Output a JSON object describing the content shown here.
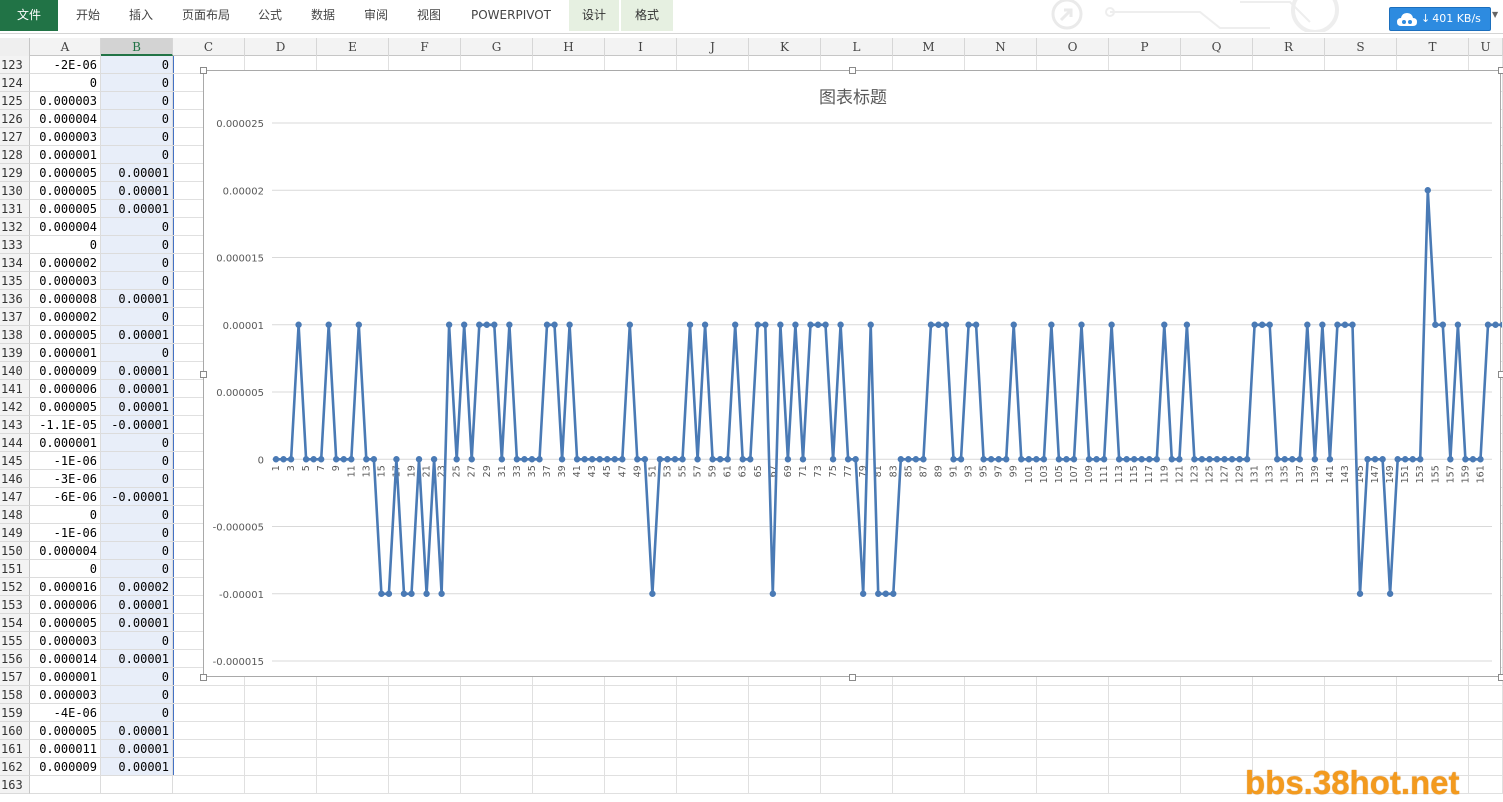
{
  "ribbon": {
    "tabs": [
      {
        "label": "文件",
        "kind": "file",
        "x": 0,
        "w": 58
      },
      {
        "label": "开始",
        "kind": "",
        "x": 62,
        "w": 52
      },
      {
        "label": "插入",
        "kind": "",
        "x": 116,
        "w": 50
      },
      {
        "label": "页面布局",
        "kind": "",
        "x": 170,
        "w": 72
      },
      {
        "label": "公式",
        "kind": "",
        "x": 245,
        "w": 50
      },
      {
        "label": "数据",
        "kind": "",
        "x": 298,
        "w": 50
      },
      {
        "label": "审阅",
        "kind": "",
        "x": 351,
        "w": 50
      },
      {
        "label": "视图",
        "kind": "",
        "x": 404,
        "w": 50
      },
      {
        "label": "POWERPIVOT",
        "kind": "",
        "x": 459,
        "w": 104
      },
      {
        "label": "设计",
        "kind": "ctx",
        "x": 569,
        "w": 50
      },
      {
        "label": "格式",
        "kind": "ctx",
        "x": 621,
        "w": 52
      }
    ],
    "speed": "401 KB/s"
  },
  "columns": [
    "A",
    "B",
    "C",
    "D",
    "E",
    "F",
    "G",
    "H",
    "I",
    "J",
    "K",
    "L",
    "M",
    "N",
    "O",
    "P",
    "Q",
    "R",
    "S",
    "T",
    "U"
  ],
  "rows": [
    {
      "n": "123",
      "a": "-2E-06",
      "b": "0"
    },
    {
      "n": "124",
      "a": "0",
      "b": "0"
    },
    {
      "n": "125",
      "a": "0.000003",
      "b": "0"
    },
    {
      "n": "126",
      "a": "0.000004",
      "b": "0"
    },
    {
      "n": "127",
      "a": "0.000003",
      "b": "0"
    },
    {
      "n": "128",
      "a": "0.000001",
      "b": "0"
    },
    {
      "n": "129",
      "a": "0.000005",
      "b": "0.00001"
    },
    {
      "n": "130",
      "a": "0.000005",
      "b": "0.00001"
    },
    {
      "n": "131",
      "a": "0.000005",
      "b": "0.00001"
    },
    {
      "n": "132",
      "a": "0.000004",
      "b": "0"
    },
    {
      "n": "133",
      "a": "0",
      "b": "0"
    },
    {
      "n": "134",
      "a": "0.000002",
      "b": "0"
    },
    {
      "n": "135",
      "a": "0.000003",
      "b": "0"
    },
    {
      "n": "136",
      "a": "0.000008",
      "b": "0.00001"
    },
    {
      "n": "137",
      "a": "0.000002",
      "b": "0"
    },
    {
      "n": "138",
      "a": "0.000005",
      "b": "0.00001"
    },
    {
      "n": "139",
      "a": "0.000001",
      "b": "0"
    },
    {
      "n": "140",
      "a": "0.000009",
      "b": "0.00001"
    },
    {
      "n": "141",
      "a": "0.000006",
      "b": "0.00001"
    },
    {
      "n": "142",
      "a": "0.000005",
      "b": "0.00001"
    },
    {
      "n": "143",
      "a": "-1.1E-05",
      "b": "-0.00001"
    },
    {
      "n": "144",
      "a": "0.000001",
      "b": "0"
    },
    {
      "n": "145",
      "a": "-1E-06",
      "b": "0"
    },
    {
      "n": "146",
      "a": "-3E-06",
      "b": "0"
    },
    {
      "n": "147",
      "a": "-6E-06",
      "b": "-0.00001"
    },
    {
      "n": "148",
      "a": "0",
      "b": "0"
    },
    {
      "n": "149",
      "a": "-1E-06",
      "b": "0"
    },
    {
      "n": "150",
      "a": "0.000004",
      "b": "0"
    },
    {
      "n": "151",
      "a": "0",
      "b": "0"
    },
    {
      "n": "152",
      "a": "0.000016",
      "b": "0.00002"
    },
    {
      "n": "153",
      "a": "0.000006",
      "b": "0.00001"
    },
    {
      "n": "154",
      "a": "0.000005",
      "b": "0.00001"
    },
    {
      "n": "155",
      "a": "0.000003",
      "b": "0"
    },
    {
      "n": "156",
      "a": "0.000014",
      "b": "0.00001"
    },
    {
      "n": "157",
      "a": "0.000001",
      "b": "0"
    },
    {
      "n": "158",
      "a": "0.000003",
      "b": "0"
    },
    {
      "n": "159",
      "a": "-4E-06",
      "b": "0"
    },
    {
      "n": "160",
      "a": "0.000005",
      "b": "0.00001"
    },
    {
      "n": "161",
      "a": "0.000011",
      "b": "0.00001"
    },
    {
      "n": "162",
      "a": "0.000009",
      "b": "0.00001"
    },
    {
      "n": "163",
      "a": "",
      "b": ""
    }
  ],
  "watermark": "bbs.38hot.net",
  "chart_data": {
    "type": "line",
    "title": "图表标题",
    "ylim": [
      -1.5e-05,
      2.5e-05
    ],
    "yticks": [
      "0.000025",
      "0.00002",
      "0.000015",
      "0.00001",
      "0.000005",
      "0",
      "-0.000005",
      "-0.00001",
      "-0.000015"
    ],
    "ytick_values": [
      2.5e-05,
      2e-05,
      1.5e-05,
      1e-05,
      5e-06,
      0,
      -5e-06,
      -1e-05,
      -1.5e-05
    ],
    "x_label_step": 2,
    "grid": true,
    "legend": "none",
    "series_color": "#4a7ab5",
    "x": [
      1,
      2,
      3,
      4,
      5,
      6,
      7,
      8,
      9,
      10,
      11,
      12,
      13,
      14,
      15,
      16,
      17,
      18,
      19,
      20,
      21,
      22,
      23,
      24,
      25,
      26,
      27,
      28,
      29,
      30,
      31,
      32,
      33,
      34,
      35,
      36,
      37,
      38,
      39,
      40,
      41,
      42,
      43,
      44,
      45,
      46,
      47,
      48,
      49,
      50,
      51,
      52,
      53,
      54,
      55,
      56,
      57,
      58,
      59,
      60,
      61,
      62,
      63,
      64,
      65,
      66,
      67,
      68,
      69,
      70,
      71,
      72,
      73,
      74,
      75,
      76,
      77,
      78,
      79,
      80,
      81,
      82,
      83,
      84,
      85,
      86,
      87,
      88,
      89,
      90,
      91,
      92,
      93,
      94,
      95,
      96,
      97,
      98,
      99,
      100,
      101,
      102,
      103,
      104,
      105,
      106,
      107,
      108,
      109,
      110,
      111,
      112,
      113,
      114,
      115,
      116,
      117,
      118,
      119,
      120,
      121,
      122,
      123,
      124,
      125,
      126,
      127,
      128,
      129,
      130,
      131,
      132,
      133,
      134,
      135,
      136,
      137,
      138,
      139,
      140,
      141,
      142,
      143,
      144,
      145,
      146,
      147,
      148,
      149,
      150,
      151,
      152,
      153,
      154,
      155,
      156,
      157,
      158,
      159,
      160,
      161,
      162
    ],
    "values": [
      0,
      0,
      0,
      1e-05,
      0,
      0,
      0,
      1e-05,
      0,
      0,
      0,
      1e-05,
      0,
      0,
      -1e-05,
      -1e-05,
      0,
      -1e-05,
      -1e-05,
      0,
      -1e-05,
      0,
      -1e-05,
      1e-05,
      0,
      1e-05,
      0,
      1e-05,
      1e-05,
      1e-05,
      0,
      1e-05,
      0,
      0,
      0,
      0,
      1e-05,
      1e-05,
      0,
      1e-05,
      0,
      0,
      0,
      0,
      0,
      0,
      0,
      1e-05,
      0,
      0,
      -1e-05,
      0,
      0,
      0,
      0,
      1e-05,
      0,
      1e-05,
      0,
      0,
      0,
      1e-05,
      0,
      0,
      1e-05,
      1e-05,
      -1e-05,
      1e-05,
      0,
      1e-05,
      0,
      1e-05,
      1e-05,
      1e-05,
      0,
      1e-05,
      0,
      0,
      -1e-05,
      1e-05,
      -1e-05,
      -1e-05,
      -1e-05,
      0,
      0,
      0,
      0,
      1e-05,
      1e-05,
      1e-05,
      0,
      0,
      1e-05,
      1e-05,
      0,
      0,
      0,
      0,
      1e-05,
      0,
      0,
      0,
      0,
      1e-05,
      0,
      0,
      0,
      1e-05,
      0,
      0,
      0,
      1e-05,
      0,
      0,
      0,
      0,
      0,
      0,
      1e-05,
      0,
      0,
      1e-05,
      0,
      0,
      0,
      0,
      0,
      0,
      0,
      0,
      1e-05,
      1e-05,
      1e-05,
      0,
      0,
      0,
      0,
      1e-05,
      0,
      1e-05,
      0,
      1e-05,
      1e-05,
      1e-05,
      -1e-05,
      0,
      0,
      0,
      -1e-05,
      0,
      0,
      0,
      0,
      2e-05,
      1e-05,
      1e-05,
      0,
      1e-05,
      0,
      0,
      0,
      1e-05,
      1e-05,
      1e-05
    ]
  }
}
